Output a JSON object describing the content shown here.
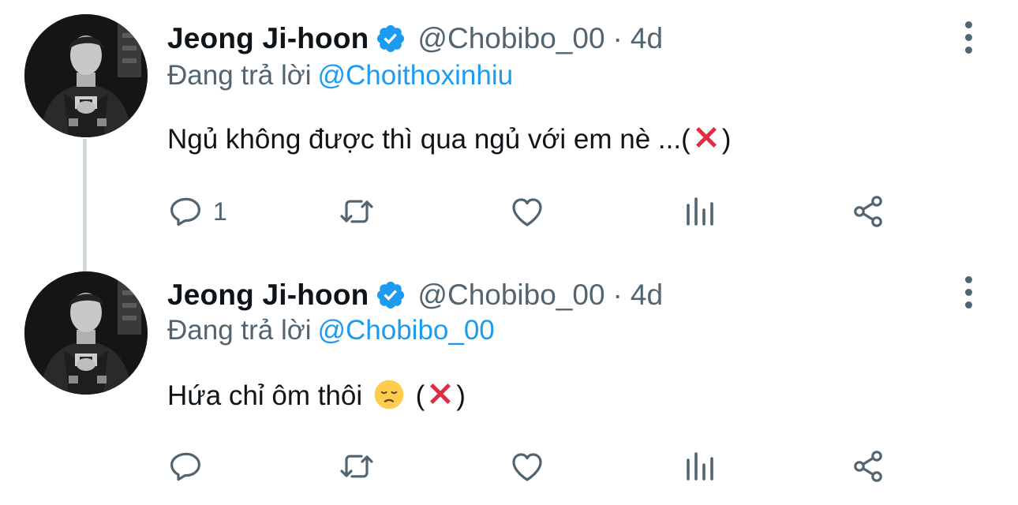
{
  "colors": {
    "text": "#0f1419",
    "secondary": "#536471",
    "link": "#1d9bf0",
    "thread_line": "#cfd9de",
    "verified": "#1d9bf0",
    "red_x": "#dd2e44"
  },
  "icons": {
    "verified": "verified-badge-icon",
    "more": "more-vertical-icon",
    "reply": "reply-icon",
    "retweet": "retweet-icon",
    "like": "heart-icon",
    "stats": "stats-icon",
    "share": "share-icon"
  },
  "tweets": [
    {
      "author": {
        "name": "Jeong Ji-hoon",
        "handle": "@Chobibo_00"
      },
      "time_sep": "·",
      "time": "4d",
      "reply_prefix": "Đang trả lời",
      "reply_to": "@Choithoxinhiu",
      "text_before": "Ngủ không được thì qua ngủ với em nè ...(",
      "text_after": ")",
      "reply_count": "1"
    },
    {
      "author": {
        "name": "Jeong Ji-hoon",
        "handle": "@Chobibo_00"
      },
      "time_sep": "·",
      "time": "4d",
      "reply_prefix": "Đang trả lời",
      "reply_to": "@Chobibo_00",
      "text_before": "Hứa chỉ ôm thôi",
      "text_middle": "(",
      "text_after": ")",
      "reply_count": ""
    }
  ]
}
